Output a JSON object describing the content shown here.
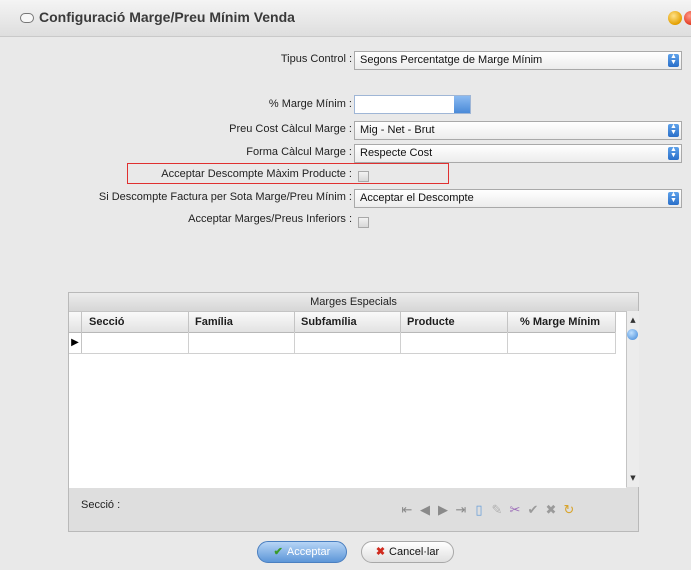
{
  "window": {
    "title": "Configuració Marge/Preu Mínim Venda"
  },
  "form": {
    "tipus_control": {
      "label": "Tipus Control :",
      "value": "Segons Percentatge de Marge Mínim"
    },
    "marge_minim": {
      "label": "% Marge Mínim :",
      "value": ""
    },
    "preu_cost": {
      "label": "Preu Cost Càlcul Marge :",
      "value": "Mig - Net - Brut"
    },
    "forma_calcul": {
      "label": "Forma Càlcul Marge :",
      "value": "Respecte Cost"
    },
    "acceptar_descompte": {
      "label": "Acceptar Descompte Màxim Producte :",
      "checked": false
    },
    "si_descompte": {
      "label": "Si Descompte Factura per Sota Marge/Preu Mínim :",
      "value": "Acceptar el Descompte"
    },
    "acceptar_marges": {
      "label": "Acceptar Marges/Preus Inferiors :",
      "checked": false
    }
  },
  "grid": {
    "caption": "Marges Especials",
    "columns": [
      "Secció",
      "Família",
      "Subfamília",
      "Producte",
      "% Marge Mínim"
    ],
    "rows": [
      [
        "",
        "",
        "",
        "",
        ""
      ]
    ],
    "footer_label": "Secció :"
  },
  "navigator": {
    "icons": [
      "first-icon",
      "prior-icon",
      "next-icon",
      "last-icon",
      "insert-icon",
      "edit-icon",
      "delete-icon",
      "post-icon",
      "cancel-icon",
      "refresh-icon"
    ]
  },
  "buttons": {
    "accept": "Acceptar",
    "cancel": "Cancel·lar"
  },
  "colors": {
    "accent": "#3b84d6",
    "highlight": "#e03030"
  }
}
